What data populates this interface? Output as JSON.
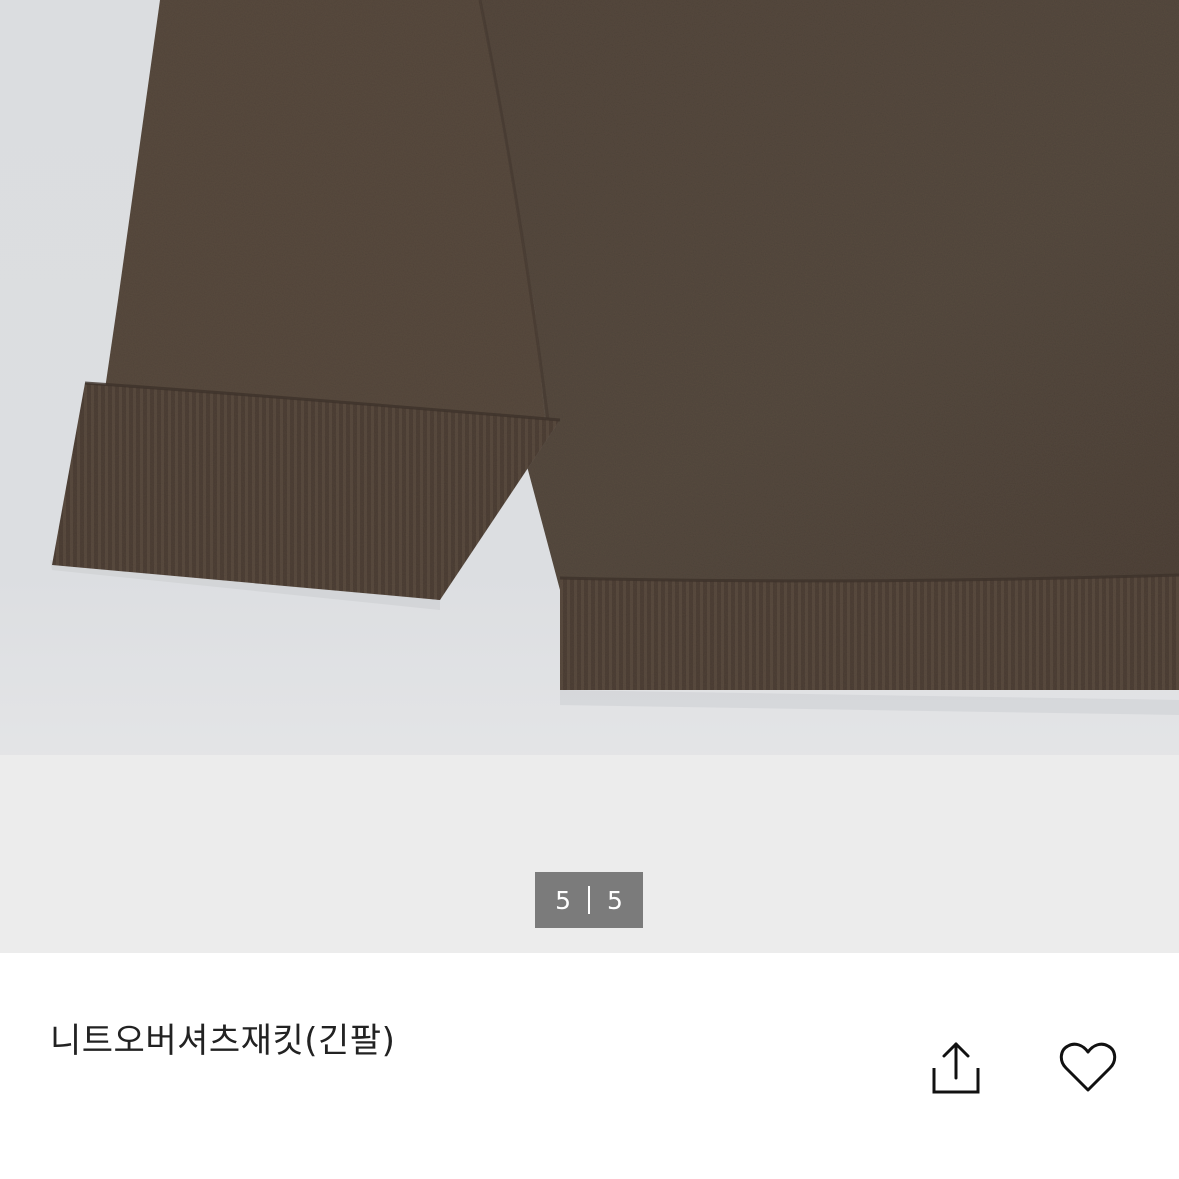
{
  "gallery": {
    "current_index": "5",
    "total_count": "5",
    "image_subject": "knit-sweater"
  },
  "product": {
    "name": "니트오버셔츠재킷(긴팔)"
  },
  "actions": {
    "share_icon": "share-icon",
    "like_icon": "heart-icon"
  },
  "colors": {
    "knit_brown": "#54463b",
    "background_gray": "#dcdee1",
    "pager_bg": "#7b7b7b",
    "text": "#222222"
  }
}
